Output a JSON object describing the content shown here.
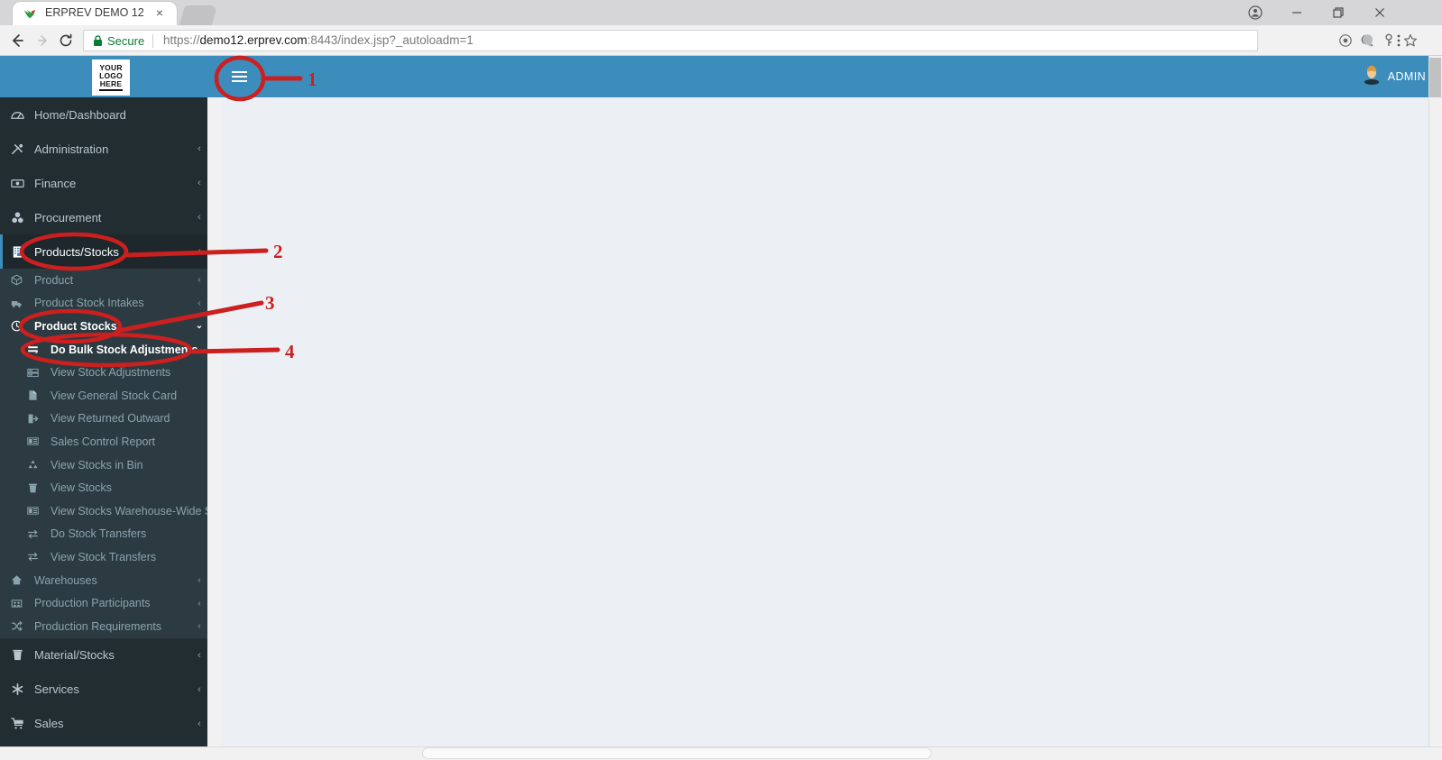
{
  "browser": {
    "tab": {
      "title": "ERPREV DEMO 12",
      "favicon": "bird-favicon",
      "close_label": "×"
    },
    "new_tab_label": "new-tab",
    "window_controls": {
      "profile": "profile-icon",
      "minimize": "–",
      "maximize": "❑",
      "close": "✕"
    },
    "nav": {
      "back": "←",
      "forward": "→",
      "reload": "⟳"
    },
    "omnibox": {
      "security_label": "Secure",
      "url_scheme": "https://",
      "url_host": "demo12.erprev.com",
      "url_rest": ":8443/index.jsp?_autoloadm=1",
      "url_full": "https://demo12.erprev.com:8443/index.jsp?_autoloadm=1"
    },
    "omnibox_icons": [
      "cast-icon",
      "zoom-out-icon",
      "key-icon",
      "star-icon"
    ],
    "extension_icon": "extension-icon",
    "menu_icon": "kebab-menu-icon"
  },
  "app": {
    "logo": {
      "line1": "YOUR",
      "line2": "LOGO",
      "line3": "HERE"
    },
    "sidebar_toggle_icon": "hamburger-icon",
    "user": {
      "name": "ADMIN",
      "avatar": "user-avatar"
    },
    "colors": {
      "header_blue": "#3c8dbc",
      "sidebar_dark": "#222d32",
      "submenu_dark": "#2c3b41",
      "content_bg": "#ecf0f5",
      "annotation_red": "#cc1f1f"
    }
  },
  "sidebar": {
    "items": [
      {
        "label": "Home/Dashboard",
        "icon": "dashboard-icon",
        "chevron": "",
        "active": false
      },
      {
        "label": "Administration",
        "icon": "tools-icon",
        "chevron": "‹",
        "active": false
      },
      {
        "label": "Finance",
        "icon": "money-icon",
        "chevron": "‹",
        "active": false
      },
      {
        "label": "Procurement",
        "icon": "procurement-icon",
        "chevron": "‹",
        "active": false
      },
      {
        "label": "Products/Stocks",
        "icon": "building-icon",
        "chevron": "‹",
        "active": true
      }
    ],
    "submenu": [
      {
        "label": "Product",
        "icon": "box-icon",
        "chevron": "‹",
        "level": 1,
        "state": ""
      },
      {
        "label": "Product Stock Intakes",
        "icon": "truck-icon",
        "chevron": "‹",
        "level": 1,
        "state": ""
      },
      {
        "label": "Product Stocks",
        "icon": "clock-icon",
        "chevron": "⌄",
        "level": 1,
        "state": "expanded"
      },
      {
        "label": "Do Bulk Stock Adjustments",
        "icon": "adjust-icon",
        "chevron": "",
        "level": 2,
        "state": "highlight"
      },
      {
        "label": "View Stock Adjustments",
        "icon": "list-icon",
        "chevron": "",
        "level": 2,
        "state": ""
      },
      {
        "label": "View General Stock Card",
        "icon": "file-icon",
        "chevron": "",
        "level": 2,
        "state": ""
      },
      {
        "label": "View Returned Outward",
        "icon": "exit-icon",
        "chevron": "",
        "level": 2,
        "state": ""
      },
      {
        "label": "Sales Control Report",
        "icon": "report-icon",
        "chevron": "",
        "level": 2,
        "state": ""
      },
      {
        "label": "View Stocks in Bin",
        "icon": "recycle-icon",
        "chevron": "",
        "level": 2,
        "state": ""
      },
      {
        "label": "View Stocks",
        "icon": "trash-icon",
        "chevron": "",
        "level": 2,
        "state": ""
      },
      {
        "label": "View Stocks Warehouse-Wide She",
        "icon": "report-icon",
        "chevron": "",
        "level": 2,
        "state": ""
      },
      {
        "label": "Do Stock Transfers",
        "icon": "transfer-icon",
        "chevron": "",
        "level": 2,
        "state": ""
      },
      {
        "label": "View Stock Transfers",
        "icon": "transfer-icon",
        "chevron": "",
        "level": 2,
        "state": ""
      },
      {
        "label": "Warehouses",
        "icon": "home-icon",
        "chevron": "‹",
        "level": 1,
        "state": ""
      },
      {
        "label": "Production Participants",
        "icon": "participants-icon",
        "chevron": "‹",
        "level": 1,
        "state": ""
      },
      {
        "label": "Production Requirements",
        "icon": "shuffle-icon",
        "chevron": "‹",
        "level": 1,
        "state": ""
      }
    ],
    "items_after": [
      {
        "label": "Material/Stocks",
        "icon": "trash-icon",
        "chevron": "‹",
        "active": false
      },
      {
        "label": "Services",
        "icon": "asterisk-icon",
        "chevron": "‹",
        "active": false
      },
      {
        "label": "Sales",
        "icon": "cart-icon",
        "chevron": "‹",
        "active": false
      }
    ]
  },
  "annotations": [
    {
      "number": "1",
      "target": "sidebar-toggle"
    },
    {
      "number": "2",
      "target": "Products/Stocks"
    },
    {
      "number": "3",
      "target": "Product Stocks"
    },
    {
      "number": "4",
      "target": "Do Bulk Stock Adjustments"
    }
  ]
}
